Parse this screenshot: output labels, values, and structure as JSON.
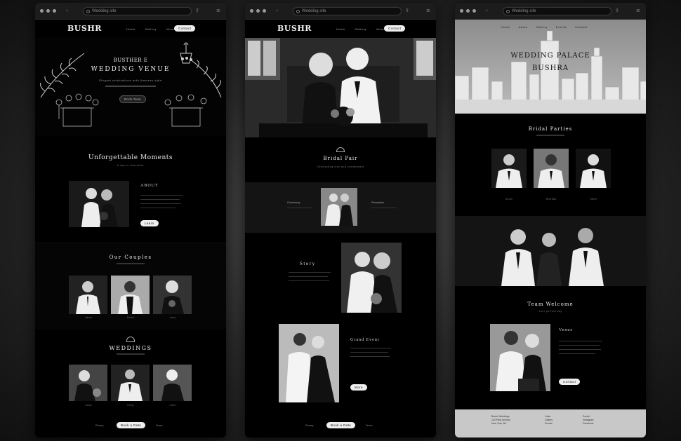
{
  "windows": [
    {
      "url": "Wedding site",
      "logo": "BUSHR",
      "nav": [
        "Home",
        "Gallery",
        "Venues"
      ],
      "nav_button": "Contact",
      "hero": {
        "title_line1": "BUSTHER E",
        "title_line2": "WEDDING VENUE",
        "subtitle": "Elegant celebrations with timeless style",
        "button": "Book Now"
      },
      "section1": {
        "title": "Unforgettable Moments",
        "subtitle": "A day to remember",
        "heading": "ABOUT",
        "button": "Learn"
      },
      "section2": {
        "title": "Our Couples",
        "captions": [
          "James",
          "Robert",
          "Anna"
        ]
      },
      "section3": {
        "title": "WEDDINGS",
        "captions": [
          "Sarah",
          "Henry",
          "Claire"
        ]
      },
      "footer": {
        "left": "Privacy",
        "button": "Book a Date",
        "right": "Terms"
      }
    },
    {
      "url": "Wedding site",
      "logo": "BUSHR",
      "nav": [
        "Home",
        "Gallery",
        "Venues"
      ],
      "nav_button": "Contact",
      "section1": {
        "title": "Bridal Pair",
        "subtitle": "Celebrating love and commitment"
      },
      "band": {
        "left": "Ceremony",
        "right": "Reception"
      },
      "section2": {
        "heading": "Story"
      },
      "section3": {
        "heading": "Grand Event",
        "button": "More"
      },
      "footer": {
        "left": "Privacy",
        "button": "Book a Date",
        "right": "Terms"
      }
    },
    {
      "url": "Wedding site",
      "nav": [
        "Home",
        "About",
        "Gallery",
        "Events",
        "Contact"
      ],
      "hero": {
        "title_line1": "WEDDING PALACE",
        "title_line2": "BUSHRA"
      },
      "team": {
        "title": "Bridal Parties",
        "captions": [
          "Groom",
          "Best Man",
          "Father"
        ]
      },
      "section2": {
        "title": "Team Welcome",
        "subtitle": "Your perfect day",
        "heading": "Venue",
        "button": "Contact"
      },
      "footer": {
        "col1": [
          "Bushr Weddings",
          "123 Park Avenue",
          "New York, NY"
        ],
        "col2": [
          "Links",
          "Gallery",
          "Events"
        ],
        "col3": [
          "Social",
          "Instagram",
          "Facebook"
        ]
      }
    }
  ],
  "colors": {
    "background": "#000000",
    "text": "#eeeeee",
    "pill": "#eeeeee"
  }
}
